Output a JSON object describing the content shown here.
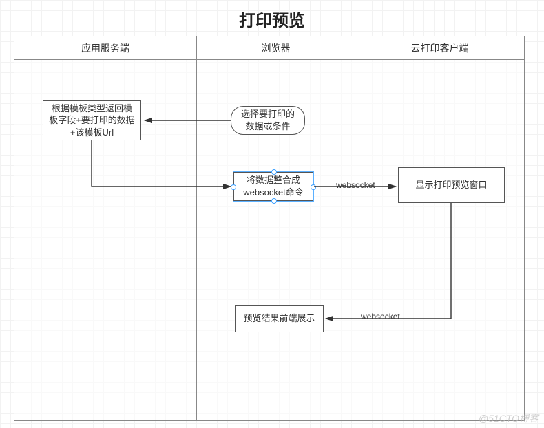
{
  "title": "打印预览",
  "lanes": {
    "server": "应用服务端",
    "browser": "浏览器",
    "client": "云打印客户端"
  },
  "nodes": {
    "select": "选择要打印的\n数据或条件",
    "prepare": "根据模板类型返回模\n板字段+要打印的数据\n+该模板Url",
    "compose": "将数据整合成\nwebsocket命令",
    "showPreview": "显示打印预览窗口",
    "result": "预览结果前端展示"
  },
  "edges": {
    "ws1": "websocket",
    "ws2": "websocket"
  },
  "watermark": "@51CTO博客"
}
